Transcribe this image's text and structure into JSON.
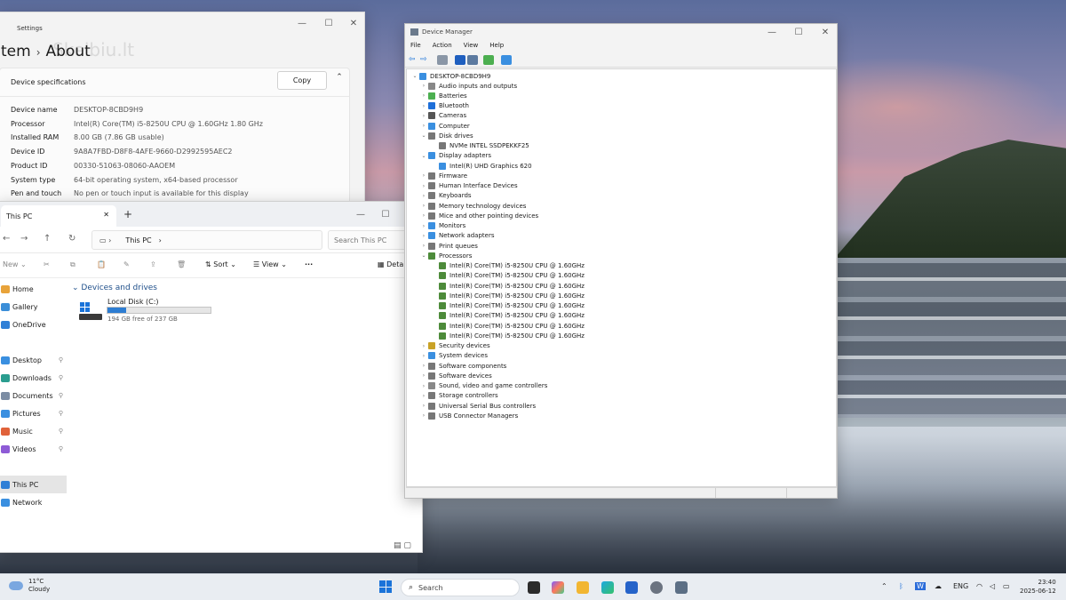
{
  "settings": {
    "window_title": "Settings",
    "breadcrumb_parent": "tem",
    "breadcrumb_current": "About",
    "watermark": "Skelbiu.lt",
    "section_title": "Device specifications",
    "copy_label": "Copy",
    "specs": [
      {
        "key": "Device name",
        "value": "DESKTOP-8CBD9H9"
      },
      {
        "key": "Processor",
        "value": "Intel(R) Core(TM) i5-8250U CPU @ 1.60GHz   1.80 GHz"
      },
      {
        "key": "Installed RAM",
        "value": "8.00 GB (7.86 GB usable)"
      },
      {
        "key": "Device ID",
        "value": "9A8A7FBD-D8F8-4AFE-9660-D2992595AEC2"
      },
      {
        "key": "Product ID",
        "value": "00330-51063-08060-AAOEM"
      },
      {
        "key": "System type",
        "value": "64-bit operating system, x64-based processor"
      },
      {
        "key": "Pen and touch",
        "value": "No pen or touch input is available for this display"
      }
    ]
  },
  "explorer": {
    "tab_label": "This PC",
    "address": "This PC",
    "search_placeholder": "Search This PC",
    "toolbar": {
      "new": "New",
      "sort": "Sort",
      "view": "View",
      "details": "Deta"
    },
    "nav": [
      {
        "label": "Home",
        "color": "#e8a33a",
        "pinned": false
      },
      {
        "label": "Gallery",
        "color": "#3b8ed8",
        "pinned": false
      },
      {
        "label": "OneDrive",
        "color": "#2f7fd6",
        "pinned": false
      },
      {
        "label": "Desktop",
        "color": "#3a8fe0",
        "pinned": true
      },
      {
        "label": "Downloads",
        "color": "#2a9d8f",
        "pinned": true
      },
      {
        "label": "Documents",
        "color": "#7b8ca3",
        "pinned": true
      },
      {
        "label": "Pictures",
        "color": "#3a8fe0",
        "pinned": true
      },
      {
        "label": "Music",
        "color": "#e0623a",
        "pinned": true
      },
      {
        "label": "Videos",
        "color": "#8e5bd6",
        "pinned": true
      },
      {
        "label": "This PC",
        "color": "#2f7fd6",
        "pinned": false,
        "selected": true
      },
      {
        "label": "Network",
        "color": "#3a8fe0",
        "pinned": false
      }
    ],
    "section": "Devices and drives",
    "drive": {
      "name": "Local Disk (C:)",
      "free_text": "194 GB free of 237 GB",
      "used_fraction": 0.18
    }
  },
  "device_manager": {
    "title": "Device Manager",
    "menu": [
      "File",
      "Action",
      "View",
      "Help"
    ],
    "root": "DESKTOP-8CBD9H9",
    "tree": [
      {
        "label": "Audio inputs and outputs",
        "level": 1,
        "expanded": false,
        "color": "#888"
      },
      {
        "label": "Batteries",
        "level": 1,
        "expanded": false,
        "color": "#4caf50"
      },
      {
        "label": "Bluetooth",
        "level": 1,
        "expanded": false,
        "color": "#1e6fd9"
      },
      {
        "label": "Cameras",
        "level": 1,
        "expanded": false,
        "color": "#555"
      },
      {
        "label": "Computer",
        "level": 1,
        "expanded": false,
        "color": "#3a8fe0"
      },
      {
        "label": "Disk drives",
        "level": 1,
        "expanded": true,
        "color": "#777"
      },
      {
        "label": "NVMe INTEL SSDPEKKF25",
        "level": 2,
        "color": "#777"
      },
      {
        "label": "Display adapters",
        "level": 1,
        "expanded": true,
        "color": "#3a8fe0"
      },
      {
        "label": "Intel(R) UHD Graphics 620",
        "level": 2,
        "color": "#3a8fe0"
      },
      {
        "label": "Firmware",
        "level": 1,
        "expanded": false,
        "color": "#777"
      },
      {
        "label": "Human Interface Devices",
        "level": 1,
        "expanded": false,
        "color": "#777"
      },
      {
        "label": "Keyboards",
        "level": 1,
        "expanded": false,
        "color": "#777"
      },
      {
        "label": "Memory technology devices",
        "level": 1,
        "expanded": false,
        "color": "#777"
      },
      {
        "label": "Mice and other pointing devices",
        "level": 1,
        "expanded": false,
        "color": "#777"
      },
      {
        "label": "Monitors",
        "level": 1,
        "expanded": false,
        "color": "#3a8fe0"
      },
      {
        "label": "Network adapters",
        "level": 1,
        "expanded": false,
        "color": "#3a8fe0"
      },
      {
        "label": "Print queues",
        "level": 1,
        "expanded": false,
        "color": "#777"
      },
      {
        "label": "Processors",
        "level": 1,
        "expanded": true,
        "color": "#4d8b3a"
      },
      {
        "label": "Intel(R) Core(TM) i5-8250U CPU @ 1.60GHz",
        "level": 2,
        "color": "#4d8b3a"
      },
      {
        "label": "Intel(R) Core(TM) i5-8250U CPU @ 1.60GHz",
        "level": 2,
        "color": "#4d8b3a"
      },
      {
        "label": "Intel(R) Core(TM) i5-8250U CPU @ 1.60GHz",
        "level": 2,
        "color": "#4d8b3a"
      },
      {
        "label": "Intel(R) Core(TM) i5-8250U CPU @ 1.60GHz",
        "level": 2,
        "color": "#4d8b3a"
      },
      {
        "label": "Intel(R) Core(TM) i5-8250U CPU @ 1.60GHz",
        "level": 2,
        "color": "#4d8b3a"
      },
      {
        "label": "Intel(R) Core(TM) i5-8250U CPU @ 1.60GHz",
        "level": 2,
        "color": "#4d8b3a"
      },
      {
        "label": "Intel(R) Core(TM) i5-8250U CPU @ 1.60GHz",
        "level": 2,
        "color": "#4d8b3a"
      },
      {
        "label": "Intel(R) Core(TM) i5-8250U CPU @ 1.60GHz",
        "level": 2,
        "color": "#4d8b3a"
      },
      {
        "label": "Security devices",
        "level": 1,
        "expanded": false,
        "color": "#c9a227"
      },
      {
        "label": "System devices",
        "level": 1,
        "expanded": false,
        "color": "#3a8fe0"
      },
      {
        "label": "Software components",
        "level": 1,
        "expanded": false,
        "color": "#777"
      },
      {
        "label": "Software devices",
        "level": 1,
        "expanded": false,
        "color": "#777"
      },
      {
        "label": "Sound, video and game controllers",
        "level": 1,
        "expanded": false,
        "color": "#888"
      },
      {
        "label": "Storage controllers",
        "level": 1,
        "expanded": false,
        "color": "#777"
      },
      {
        "label": "Universal Serial Bus controllers",
        "level": 1,
        "expanded": false,
        "color": "#777"
      },
      {
        "label": "USB Connector Managers",
        "level": 1,
        "expanded": false,
        "color": "#777"
      }
    ]
  },
  "taskbar": {
    "weather_temp": "11°C",
    "weather_cond": "Cloudy",
    "search_label": "Search",
    "language": "ENG",
    "time": "23:40",
    "date": "2025-06-12"
  }
}
